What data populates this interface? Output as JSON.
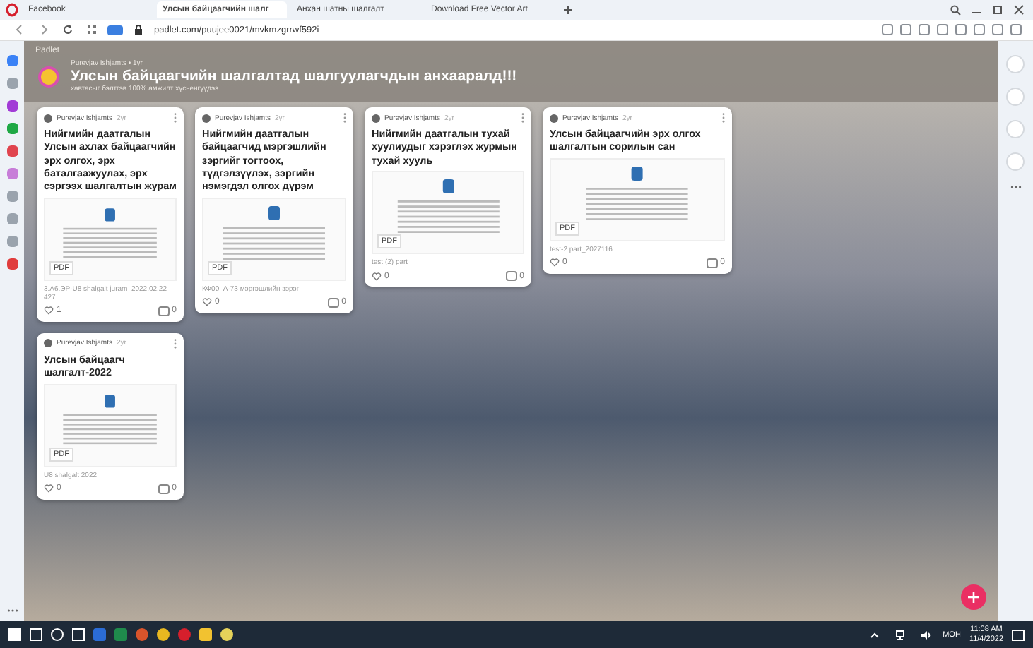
{
  "browser": {
    "tabs": [
      {
        "label": "Facebook",
        "selected": false
      },
      {
        "label": "Улсын байцаагчийн шалг",
        "selected": true
      },
      {
        "label": "Анхан шатны шалгалт",
        "selected": false
      },
      {
        "label": "Download Free Vector Art",
        "selected": false
      }
    ],
    "address": "padlet.com/puujee0021/mvkmzgrrwf592i"
  },
  "board": {
    "brand": "Padlet",
    "author_line": "Purevjav Ishjamts • 1yr",
    "title": "Улсын байцаагчийн шалгалтад шалгуулагчдын анхааралд!!!",
    "subtitle": "хавтасыг бэлтгэв 100% амжилт хүсьенгүүдээ"
  },
  "columns": [
    {
      "posts": [
        {
          "author": "Purevjav Ishjamts",
          "age": "2yr",
          "title": "Нийгмийн даатгалын Улсын ахлах байцаагчийн эрх олгох, эрх баталгаажуулах, эрх сэргээх шалгалтын журам",
          "file_type": "PDF",
          "file_name": "3.А6.ЭР-U8 shalgalt juram_2022.02.22 427",
          "likes": "1",
          "comments": "0"
        },
        {
          "author": "Purevjav Ishjamts",
          "age": "2yr",
          "title": "Улсын байцаагч шалгалт-2022",
          "file_type": "PDF",
          "file_name": "U8 shalgalt 2022",
          "likes": "0",
          "comments": "0"
        }
      ]
    },
    {
      "posts": [
        {
          "author": "Purevjav Ishjamts",
          "age": "2yr",
          "title": "Нийгмийн даатгалын байцаагчид мэргэшлийн зэргийг тогтоох, түдгэлзүүлэх, зэргийн нэмэгдэл олгох дүрэм",
          "file_type": "PDF",
          "file_name": "КФ00_А-73 мэргэшлийн зэрэг",
          "likes": "0",
          "comments": "0"
        }
      ]
    },
    {
      "posts": [
        {
          "author": "Purevjav Ishjamts",
          "age": "2yr",
          "title": "Нийгмийн даатгалын тухай хуулиудыг хэрэглэх журмын тухай хууль",
          "file_type": "PDF",
          "file_name": "test (2) part",
          "likes": "0",
          "comments": "0"
        }
      ]
    },
    {
      "posts": [
        {
          "author": "Purevjav Ishjamts",
          "age": "2yr",
          "title": "Улсын байцаагчийн эрх олгох шалгалтын сорилын сан",
          "file_type": "PDF",
          "file_name": "test-2 part_2027116",
          "likes": "0",
          "comments": "0"
        }
      ]
    }
  ],
  "taskbar": {
    "language": "МОН",
    "time": "11:08 AM",
    "date": "11/4/2022"
  }
}
